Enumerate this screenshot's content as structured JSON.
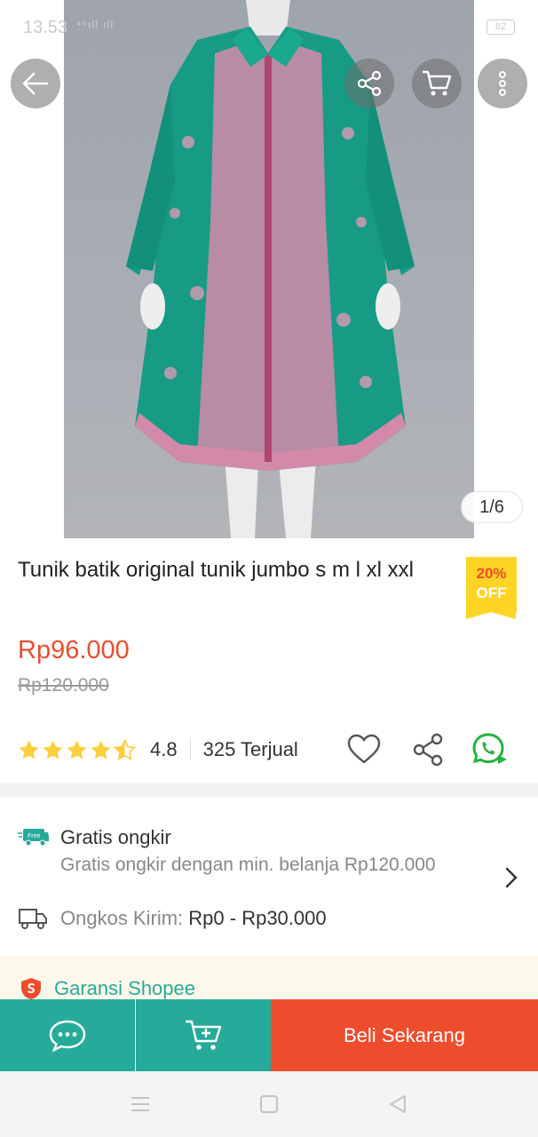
{
  "status_bar": {
    "time": "13.53",
    "signal": "⁴⁶ıll ıll",
    "battery": "82"
  },
  "gallery": {
    "indicator": "1/6"
  },
  "top_actions": {
    "back_icon": "arrow-left-icon",
    "share_icon": "share-icon",
    "cart_icon": "cart-icon",
    "more_icon": "more-vertical-icon"
  },
  "product": {
    "title": "Tunik batik original tunik jumbo s m l xl xxl",
    "discount": {
      "percent": "20%",
      "label": "OFF"
    },
    "price": "Rp96.000",
    "old_price": "Rp120.000",
    "rating": 4.8,
    "rating_text": "4.8",
    "sold": "325 Terjual"
  },
  "shipping": {
    "free_title": "Gratis ongkir",
    "free_sub": "Gratis ongkir dengan min. belanja Rp120.000",
    "free_icon_label": "Free",
    "cost_label": "Ongkos Kirim:",
    "cost_value": "Rp0 - Rp30.000"
  },
  "guarantee": {
    "label": "Garansi Shopee"
  },
  "action_bar": {
    "buy_label": "Beli Sekarang"
  },
  "colors": {
    "brand": "#ee4d2d",
    "teal": "#26aa99",
    "star": "#ffce3d",
    "badge": "#ffd424"
  }
}
